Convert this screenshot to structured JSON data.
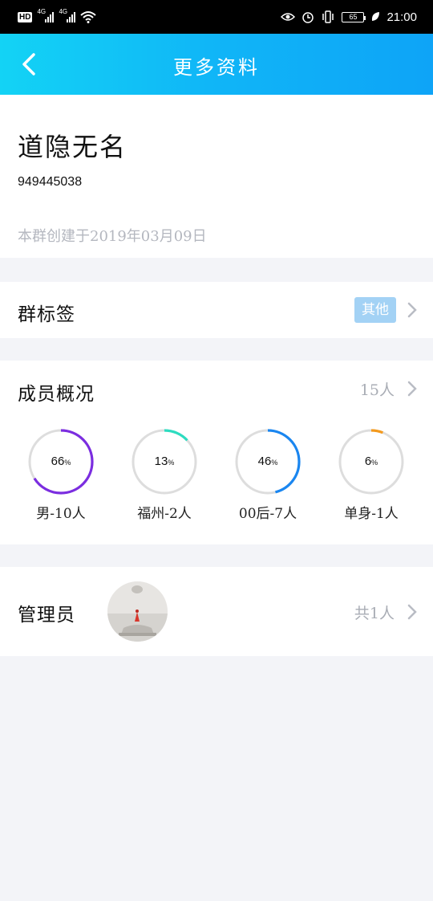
{
  "status_bar": {
    "hd": "HD",
    "net1": "4G",
    "net2": "4G",
    "battery": "65",
    "time": "21:00"
  },
  "header": {
    "title": "更多资料",
    "back_icon": "chevron-left-icon"
  },
  "group": {
    "name": "道隐无名",
    "id": "949445038",
    "created": "本群创建于2019年03月09日"
  },
  "tag_row": {
    "label": "群标签",
    "tag": "其他"
  },
  "members": {
    "label": "成员概况",
    "count": "15人",
    "stats": [
      {
        "value": 66,
        "label": "男-10人",
        "color": "#7b2de0"
      },
      {
        "value": 13,
        "label": "福州-2人",
        "color": "#2ddcc0"
      },
      {
        "value": 46,
        "label": "00后-7人",
        "color": "#1a86f0"
      },
      {
        "value": 6,
        "label": "单身-1人",
        "color": "#f39a1e"
      }
    ]
  },
  "admin": {
    "label": "管理员",
    "count": "共1人"
  },
  "colors": {
    "header_start": "#13d3f5",
    "header_end": "#0ea4f7",
    "ring_track": "#dddddd"
  }
}
